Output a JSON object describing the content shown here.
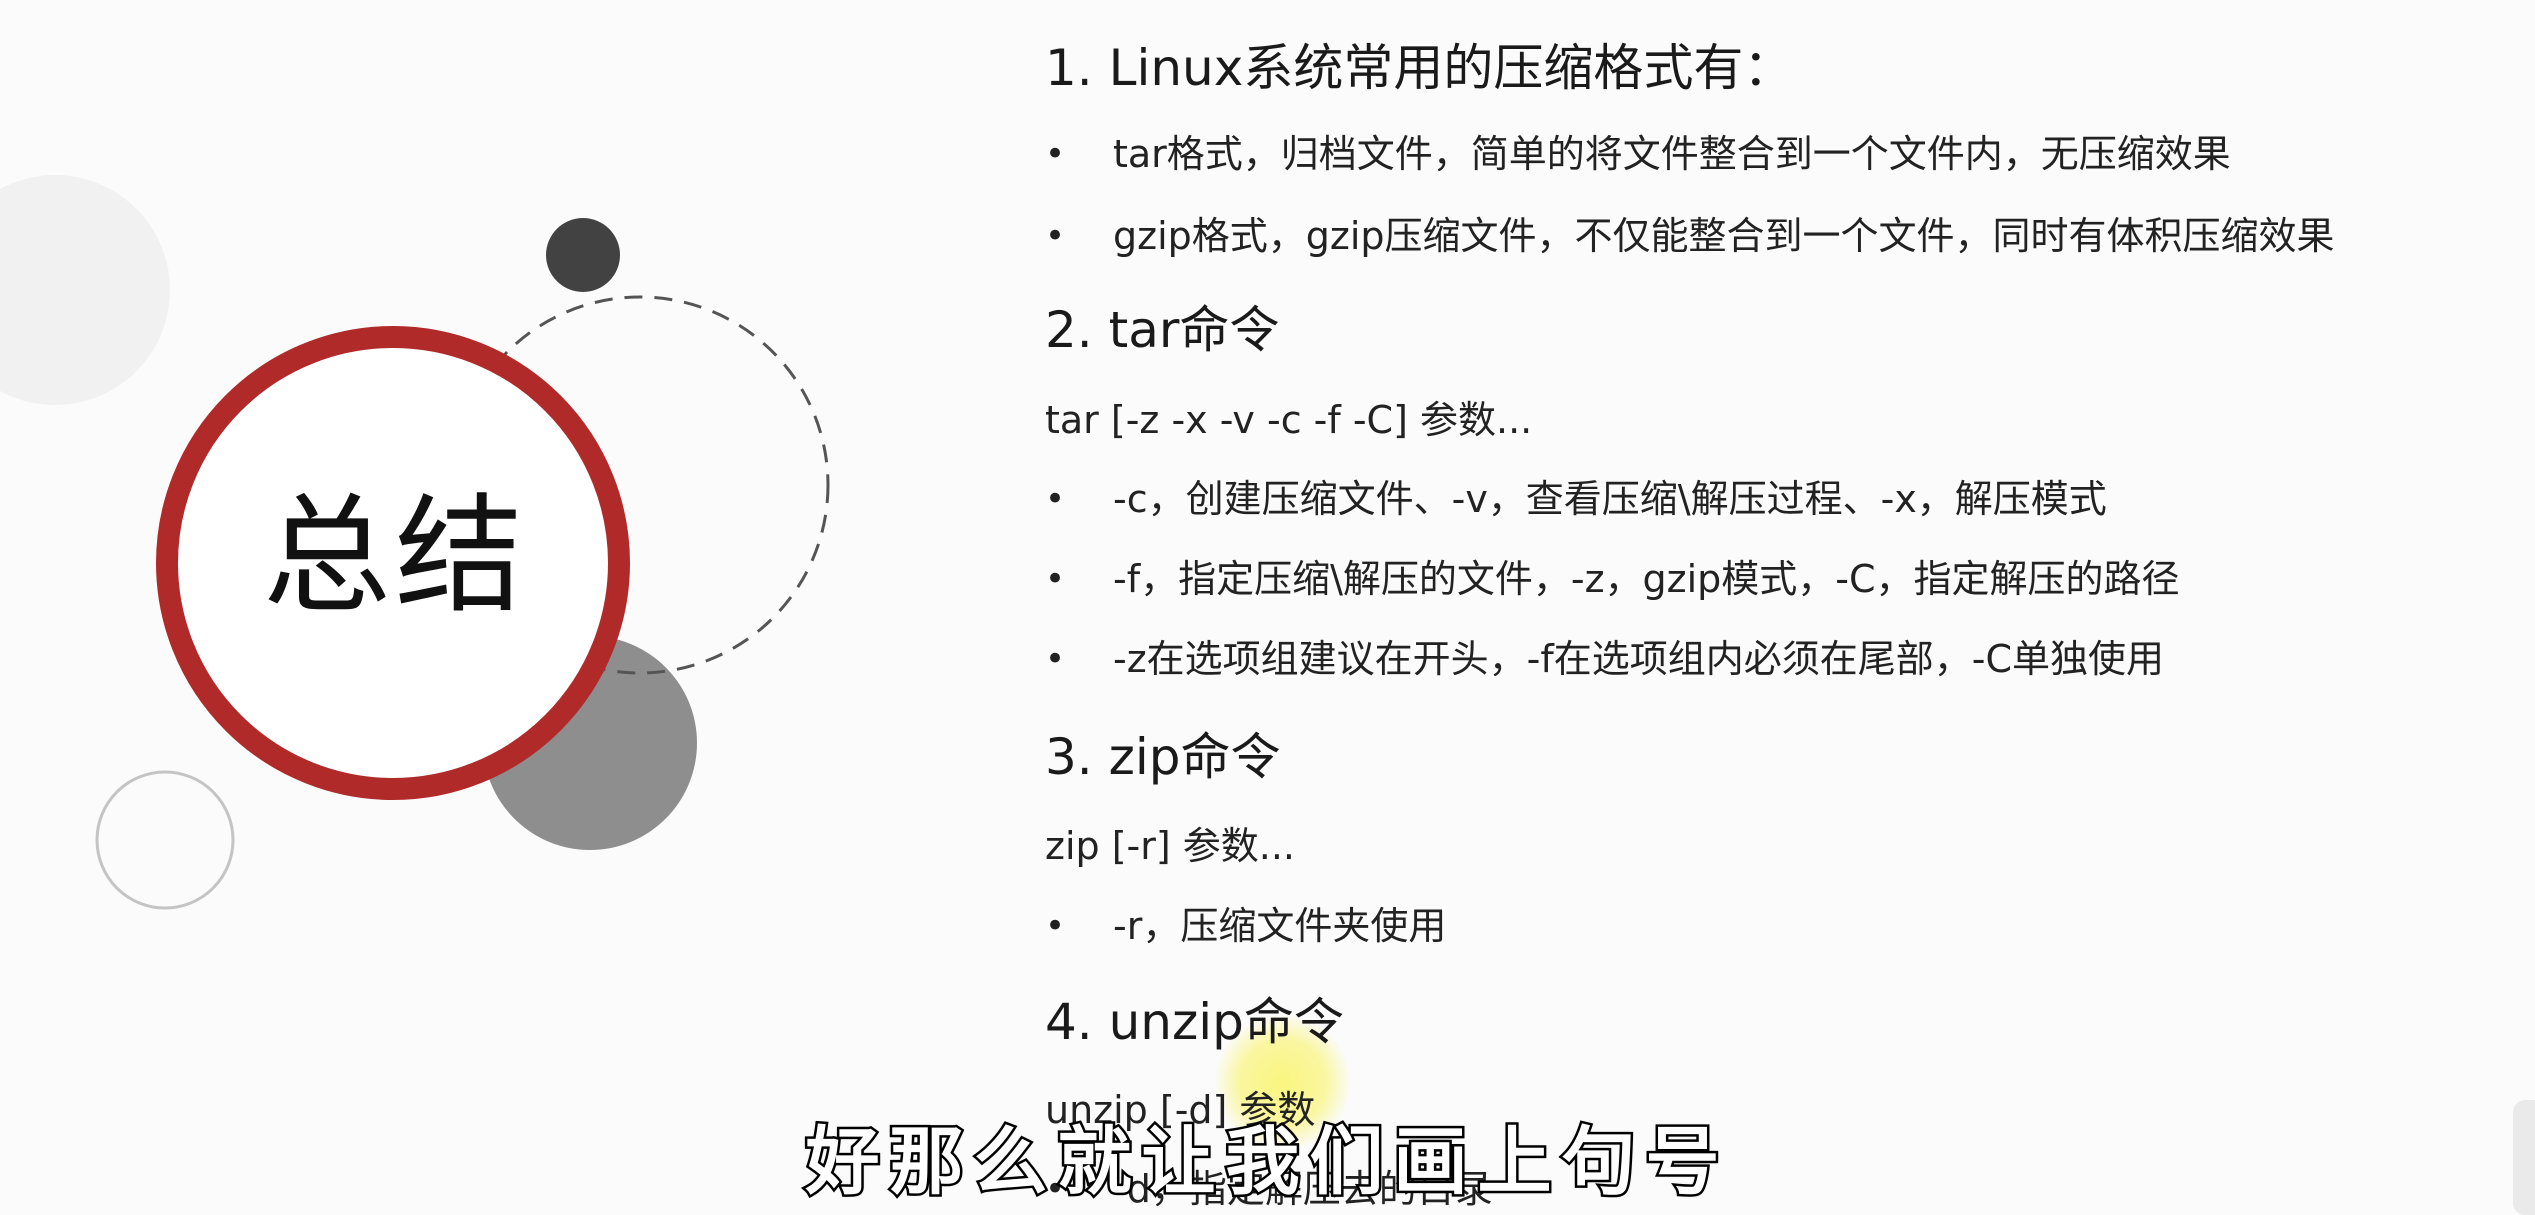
{
  "summary_title": "总结",
  "sections": [
    {
      "heading": "1. Linux系统常用的压缩格式有：",
      "syntax": "",
      "bullets": [
        "tar格式，归档文件，简单的将文件整合到一个文件内，无压缩效果",
        "gzip格式，gzip压缩文件，不仅能整合到一个文件，同时有体积压缩效果"
      ]
    },
    {
      "heading": "2. tar命令",
      "syntax": "tar [-z -x -v -c -f -C] 参数...",
      "bullets": [
        "-c，创建压缩文件、-v，查看压缩\\解压过程、-x，解压模式",
        "-f，指定压缩\\解压的文件，-z，gzip模式，-C，指定解压的路径",
        "-z在选项组建议在开头，-f在选项组内必须在尾部，-C单独使用"
      ]
    },
    {
      "heading": "3. zip命令",
      "syntax": "zip [-r] 参数...",
      "bullets": [
        "-r，压缩文件夹使用"
      ]
    },
    {
      "heading": "4. unzip命令",
      "syntax": "unzip [-d] 参数",
      "bullets": [
        "-d，指定解压去的目录"
      ]
    }
  ],
  "subtitle": "好那么就让我们画上句号",
  "colors": {
    "ring_red": "#b02a2a",
    "dark_dot": "#424242",
    "gray_circle": "#8e8e8e",
    "highlight": "#f7f27a"
  }
}
